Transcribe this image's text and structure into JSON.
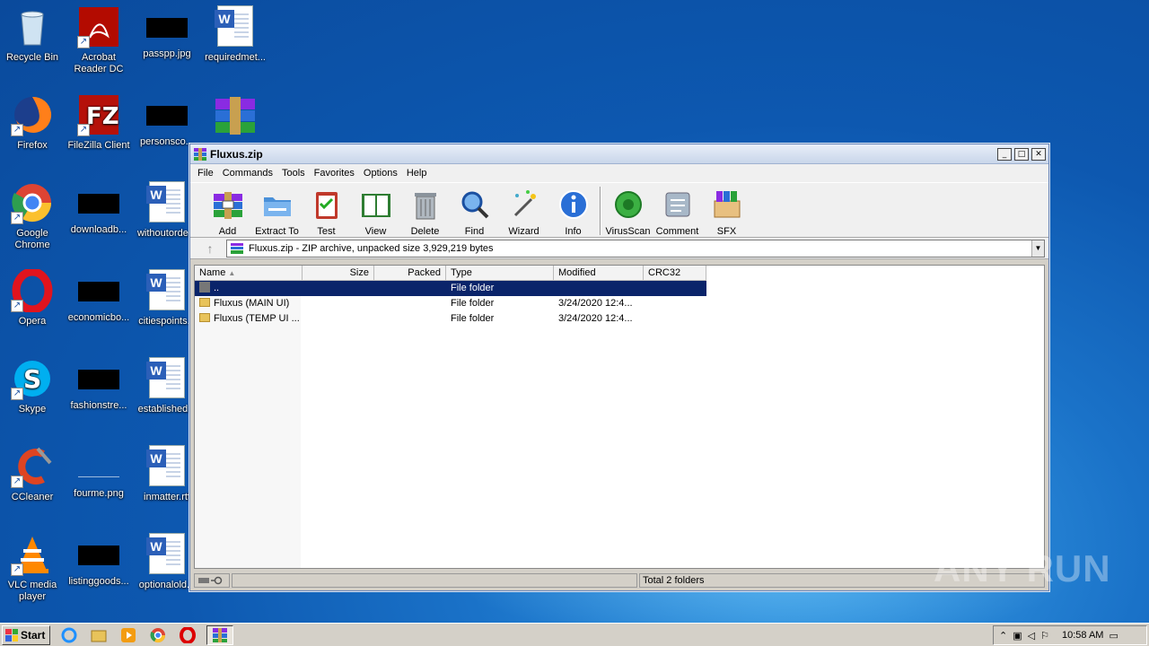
{
  "desktop": {
    "icons": [
      {
        "label": "Recycle Bin",
        "icon": "recycle-bin-icon"
      },
      {
        "label": "Acrobat Reader DC",
        "icon": "acrobat-icon"
      },
      {
        "label": "passpp.jpg",
        "icon": "image-file-icon"
      },
      {
        "label": "requiredmet...",
        "icon": "word-doc-icon"
      },
      {
        "label": "Firefox",
        "icon": "firefox-icon"
      },
      {
        "label": "FileZilla Client",
        "icon": "filezilla-icon"
      },
      {
        "label": "personsco...",
        "icon": "image-file-icon"
      },
      {
        "label": "",
        "icon": "winrar-icon"
      },
      {
        "label": "Google Chrome",
        "icon": "chrome-icon"
      },
      {
        "label": "downloadb...",
        "icon": "image-file-icon"
      },
      {
        "label": "withoutorde...",
        "icon": "word-doc-icon"
      },
      {
        "label": "Opera",
        "icon": "opera-icon"
      },
      {
        "label": "economicbo...",
        "icon": "image-file-icon"
      },
      {
        "label": "citiespoints...",
        "icon": "word-doc-icon"
      },
      {
        "label": "Skype",
        "icon": "skype-icon"
      },
      {
        "label": "fashionstre...",
        "icon": "image-file-icon"
      },
      {
        "label": "established...",
        "icon": "word-doc-icon"
      },
      {
        "label": "CCleaner",
        "icon": "ccleaner-icon"
      },
      {
        "label": "fourme.png",
        "icon": "image-file-icon"
      },
      {
        "label": "inmatter.rtf",
        "icon": "word-doc-icon"
      },
      {
        "label": "VLC media player",
        "icon": "vlc-icon"
      },
      {
        "label": "listinggoods...",
        "icon": "image-file-icon"
      },
      {
        "label": "optionalold...",
        "icon": "word-doc-icon"
      }
    ]
  },
  "window": {
    "title": "Fluxus.zip",
    "controls": {
      "minimize": "_",
      "maximize": "□",
      "close": "✕"
    },
    "menu": [
      "File",
      "Commands",
      "Tools",
      "Favorites",
      "Options",
      "Help"
    ],
    "toolbar": [
      {
        "label": "Add",
        "icon": "add-archive-icon"
      },
      {
        "label": "Extract To",
        "icon": "extract-folder-icon"
      },
      {
        "label": "Test",
        "icon": "test-clipboard-icon"
      },
      {
        "label": "View",
        "icon": "view-book-icon"
      },
      {
        "label": "Delete",
        "icon": "trash-icon"
      },
      {
        "label": "Find",
        "icon": "magnifier-icon"
      },
      {
        "label": "Wizard",
        "icon": "wand-icon"
      },
      {
        "label": "Info",
        "icon": "info-icon"
      },
      {
        "label": "VirusScan",
        "icon": "virus-scan-icon"
      },
      {
        "label": "Comment",
        "icon": "comment-icon"
      },
      {
        "label": "SFX",
        "icon": "sfx-box-icon"
      }
    ],
    "address": "Fluxus.zip - ZIP archive, unpacked size 3,929,219 bytes",
    "columns": [
      "Name",
      "Size",
      "Packed",
      "Type",
      "Modified",
      "CRC32"
    ],
    "rows": [
      {
        "name": "..",
        "size": "",
        "packed": "",
        "type": "File folder",
        "modified": "",
        "crc": ""
      },
      {
        "name": "Fluxus (MAIN UI)",
        "size": "",
        "packed": "",
        "type": "File folder",
        "modified": "3/24/2020 12:4...",
        "crc": ""
      },
      {
        "name": "Fluxus (TEMP UI ...",
        "size": "",
        "packed": "",
        "type": "File folder",
        "modified": "3/24/2020 12:4...",
        "crc": ""
      }
    ],
    "status": "Total 2 folders"
  },
  "taskbar": {
    "start_label": "Start",
    "clock": "10:58 AM"
  },
  "watermark": "ANY RUN"
}
